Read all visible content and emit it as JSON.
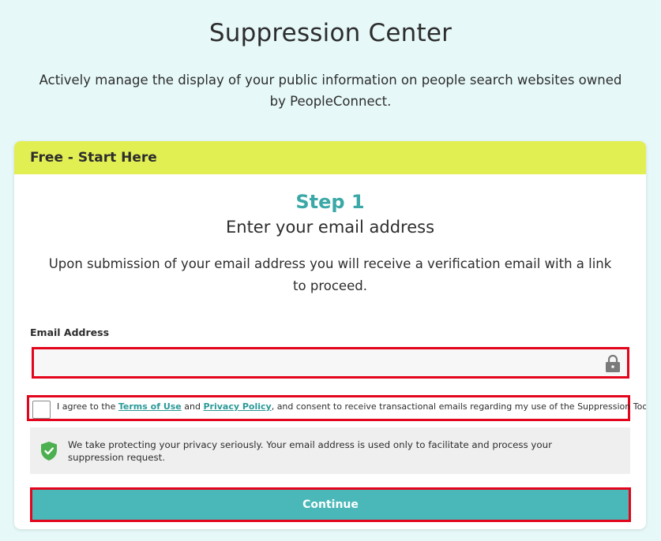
{
  "page": {
    "title": "Suppression Center",
    "subtitle": "Actively manage the display of your public information on people search websites owned by PeopleConnect."
  },
  "card": {
    "header": "Free - Start Here",
    "step_title": "Step 1",
    "step_subtitle": "Enter your email address",
    "description": "Upon submission of your email address you will receive a verification email with a link to proceed."
  },
  "form": {
    "email_label": "Email Address",
    "email_value": "",
    "email_icon": "lock-icon",
    "agree_prefix": "I agree to the ",
    "terms_link": "Terms of Use",
    "agree_and": " and ",
    "privacy_link": "Privacy Policy",
    "agree_suffix": ", and consent to receive transactional emails regarding my use of the Suppression Tool.",
    "agree_checked": false,
    "privacy_icon": "shield-check-icon",
    "privacy_note": "We take protecting your privacy seriously. Your email address is used only to facilitate and process your suppression request.",
    "continue_label": "Continue"
  },
  "colors": {
    "background": "#e6f8f8",
    "header_yellow": "#e2ef53",
    "accent_teal": "#3aa8a6",
    "button_teal": "#4ab8b8",
    "highlight_red": "#e3051b",
    "shield_green": "#4caf50"
  }
}
